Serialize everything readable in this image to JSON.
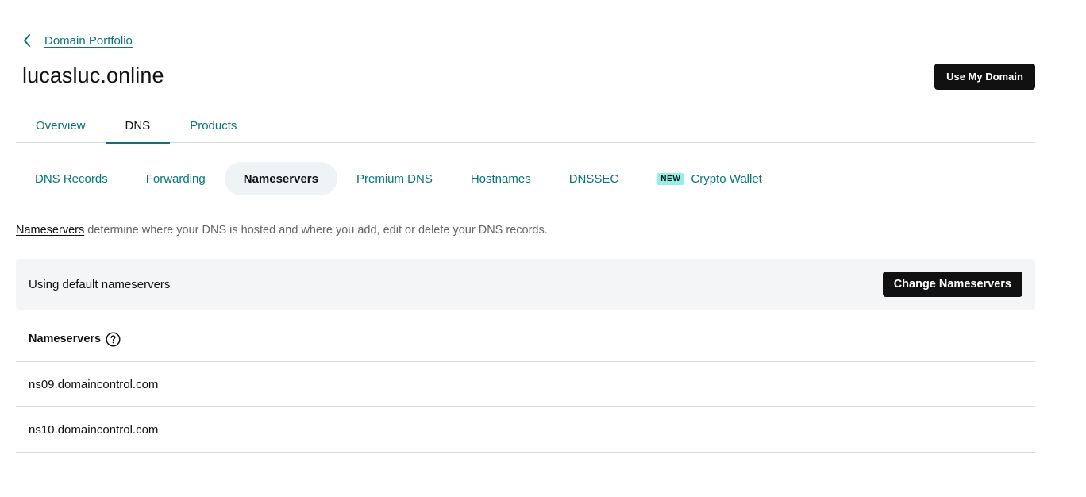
{
  "breadcrumb": {
    "label": "Domain Portfolio",
    "icon": "chevron-left-icon"
  },
  "page": {
    "title": "lucasluc.online",
    "primary_action": "Use My Domain"
  },
  "main_tabs": [
    {
      "label": "Overview",
      "active": false
    },
    {
      "label": "DNS",
      "active": true
    },
    {
      "label": "Products",
      "active": false
    }
  ],
  "sub_tabs": [
    {
      "label": "DNS Records",
      "active": false
    },
    {
      "label": "Forwarding",
      "active": false
    },
    {
      "label": "Nameservers",
      "active": true
    },
    {
      "label": "Premium DNS",
      "active": false
    },
    {
      "label": "Hostnames",
      "active": false
    },
    {
      "label": "DNSSEC",
      "active": false
    },
    {
      "label": "Crypto Wallet",
      "active": false,
      "badge": "NEW"
    }
  ],
  "description": {
    "link": "Nameservers",
    "text": " determine where your DNS is hosted and where you add, edit or delete your DNS records."
  },
  "status": {
    "text": "Using default nameservers",
    "button": "Change Nameservers"
  },
  "nameservers": {
    "header": "Nameservers",
    "help_icon": "help-circle-icon",
    "rows": [
      "ns09.domaincontrol.com",
      "ns10.domaincontrol.com"
    ]
  },
  "colors": {
    "accent": "#09757a",
    "dark_button": "#111111",
    "panel_bg": "#f3f5f6",
    "active_pill": "#eef3f6",
    "new_badge": "#8ff1ea",
    "divider": "#d4dbe0"
  }
}
